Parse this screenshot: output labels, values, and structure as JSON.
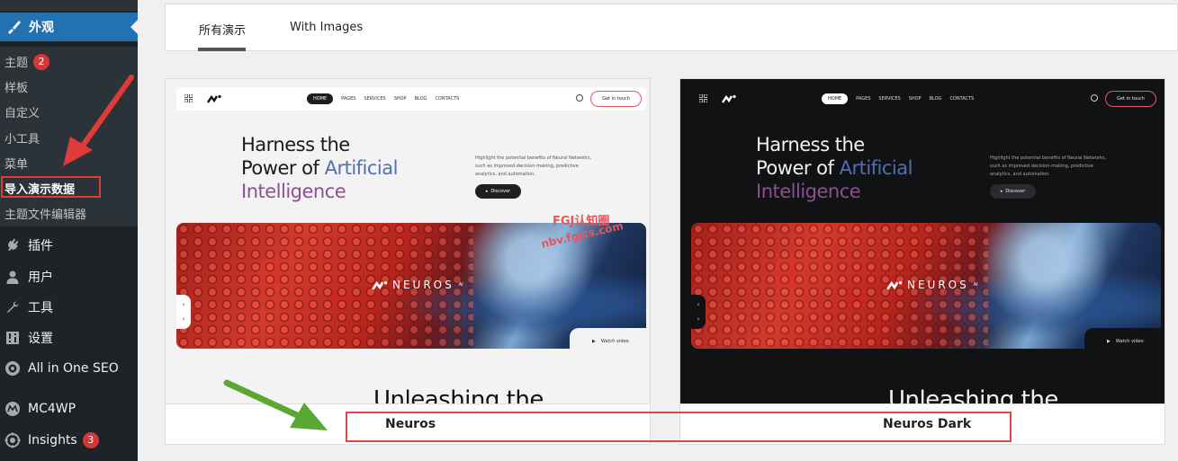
{
  "sidebar": {
    "active_menu": {
      "label": "外观",
      "icon": "paintbrush-icon"
    },
    "submenu": [
      {
        "label": "主题",
        "badge": "2"
      },
      {
        "label": "样板"
      },
      {
        "label": "自定义"
      },
      {
        "label": "小工具"
      },
      {
        "label": "菜单"
      },
      {
        "label": "导入演示数据",
        "current": true
      },
      {
        "label": "主题文件编辑器"
      }
    ],
    "menu": [
      {
        "label": "插件",
        "icon": "plugin-icon"
      },
      {
        "label": "用户",
        "icon": "user-icon"
      },
      {
        "label": "工具",
        "icon": "wrench-icon"
      },
      {
        "label": "设置",
        "icon": "settings-icon"
      },
      {
        "label": "All in One SEO",
        "icon": "aioseo-icon"
      },
      {
        "label": "MC4WP",
        "icon": "mc4wp-icon"
      },
      {
        "label": "Insights",
        "icon": "insights-icon",
        "badge": "3"
      }
    ]
  },
  "tabs": [
    {
      "label": "所有演示",
      "active": true
    },
    {
      "label": "With Images",
      "active": false
    }
  ],
  "preview": {
    "nav_links": [
      "HOME",
      "PAGES",
      "SERVICES",
      "SHOP",
      "BLOG",
      "CONTACTS"
    ],
    "cta": "Get in touch",
    "headline": {
      "line1": "Harness the",
      "line2_a": "Power of ",
      "line2_b": "Artificial",
      "line3": "Intelligence"
    },
    "description": "Highlight the potential benefits of Neural Networks, such as improved decision-making, predictive analytics, and automation.",
    "discover": "Discover",
    "hero_logo": "NEUROS",
    "hero_logo_sup": "AI",
    "watch_video": "Watch video",
    "subheading": "Unleashing the"
  },
  "demos": [
    {
      "name": "Neuros",
      "theme": "light"
    },
    {
      "name": "Neuros Dark",
      "theme": "dark"
    }
  ],
  "watermark": {
    "line1": "FGJ认知圈",
    "line2": "nbv.fgjss.com"
  },
  "colors": {
    "sidebar_bg": "#1d2327",
    "active_menu_bg": "#2271b1",
    "badge": "#d63638",
    "annotation_red": "#e03a3a",
    "annotation_green": "#5aa832",
    "headline_blue": "#4f6fb6",
    "headline_purple": "#8e4e8f"
  }
}
